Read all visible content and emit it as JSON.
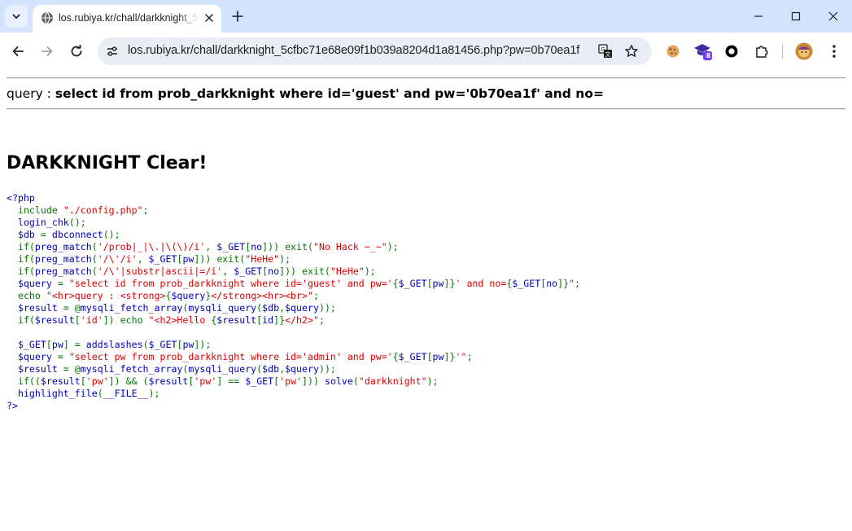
{
  "browser": {
    "tab": {
      "title": "los.rubiya.kr/chall/darkknight_5"
    },
    "url": "los.rubiya.kr/chall/darkknight_5cfbc71e68e09f1b039a8204d1a81456.php?pw=0b70ea1f",
    "extension_badge": "8",
    "icons": {
      "tab_search": "chevron-down-icon",
      "favicon": "globe-icon",
      "close": "close-icon",
      "new_tab": "plus-icon",
      "minimize": "minimize-icon",
      "maximize": "maximize-icon",
      "window_close": "close-icon",
      "back": "back-arrow-icon",
      "forward": "forward-arrow-icon",
      "reload": "reload-icon",
      "site_info": "tune-icon",
      "translate": "translate-icon",
      "bookmark": "star-icon",
      "extensions": "puzzle-icon",
      "menu": "kebab-menu-icon"
    }
  },
  "page": {
    "query_label": "query : ",
    "query_text": "select id from prob_darkknight where id='guest' and pw='0b70ea1f' and no=",
    "clear_message": "DARKKNIGHT Clear!",
    "source_lines": [
      [
        {
          "c": "d",
          "t": "<?php"
        }
      ],
      [
        {
          "c": "k",
          "t": "  include "
        },
        {
          "c": "s",
          "t": "\"./config.php\""
        },
        {
          "c": "k",
          "t": ";"
        }
      ],
      [
        {
          "c": "d",
          "t": "  login_chk"
        },
        {
          "c": "k",
          "t": "();"
        }
      ],
      [
        {
          "c": "d",
          "t": "  $db "
        },
        {
          "c": "k",
          "t": "= "
        },
        {
          "c": "d",
          "t": "dbconnect"
        },
        {
          "c": "k",
          "t": "();"
        }
      ],
      [
        {
          "c": "k",
          "t": "  if("
        },
        {
          "c": "d",
          "t": "preg_match"
        },
        {
          "c": "k",
          "t": "("
        },
        {
          "c": "s",
          "t": "'/prob|_|\\.|\\(\\)/i'"
        },
        {
          "c": "k",
          "t": ", "
        },
        {
          "c": "d",
          "t": "$_GET"
        },
        {
          "c": "k",
          "t": "["
        },
        {
          "c": "d",
          "t": "no"
        },
        {
          "c": "k",
          "t": "])) exit("
        },
        {
          "c": "s",
          "t": "\"No Hack ~_~\""
        },
        {
          "c": "k",
          "t": ");"
        }
      ],
      [
        {
          "c": "k",
          "t": "  if("
        },
        {
          "c": "d",
          "t": "preg_match"
        },
        {
          "c": "k",
          "t": "("
        },
        {
          "c": "s",
          "t": "'/\\'/i'"
        },
        {
          "c": "k",
          "t": ", "
        },
        {
          "c": "d",
          "t": "$_GET"
        },
        {
          "c": "k",
          "t": "["
        },
        {
          "c": "d",
          "t": "pw"
        },
        {
          "c": "k",
          "t": "])) exit("
        },
        {
          "c": "s",
          "t": "\"HeHe\""
        },
        {
          "c": "k",
          "t": ");"
        }
      ],
      [
        {
          "c": "k",
          "t": "  if("
        },
        {
          "c": "d",
          "t": "preg_match"
        },
        {
          "c": "k",
          "t": "("
        },
        {
          "c": "s",
          "t": "'/\\'|substr|ascii|=/i'"
        },
        {
          "c": "k",
          "t": ", "
        },
        {
          "c": "d",
          "t": "$_GET"
        },
        {
          "c": "k",
          "t": "["
        },
        {
          "c": "d",
          "t": "no"
        },
        {
          "c": "k",
          "t": "])) exit("
        },
        {
          "c": "s",
          "t": "\"HeHe\""
        },
        {
          "c": "k",
          "t": ");"
        }
      ],
      [
        {
          "c": "d",
          "t": "  $query "
        },
        {
          "c": "k",
          "t": "= "
        },
        {
          "c": "s",
          "t": "\"select id from prob_darkknight where id='guest' and pw='"
        },
        {
          "c": "k",
          "t": "{"
        },
        {
          "c": "d",
          "t": "$_GET"
        },
        {
          "c": "k",
          "t": "["
        },
        {
          "c": "d",
          "t": "pw"
        },
        {
          "c": "k",
          "t": "]}"
        },
        {
          "c": "s",
          "t": "' and no="
        },
        {
          "c": "k",
          "t": "{"
        },
        {
          "c": "d",
          "t": "$_GET"
        },
        {
          "c": "k",
          "t": "["
        },
        {
          "c": "d",
          "t": "no"
        },
        {
          "c": "k",
          "t": "]}"
        },
        {
          "c": "s",
          "t": "\""
        },
        {
          "c": "k",
          "t": ";"
        }
      ],
      [
        {
          "c": "k",
          "t": "  echo "
        },
        {
          "c": "s",
          "t": "\"<hr>query : <strong>"
        },
        {
          "c": "k",
          "t": "{"
        },
        {
          "c": "d",
          "t": "$query"
        },
        {
          "c": "k",
          "t": "}"
        },
        {
          "c": "s",
          "t": "</strong><hr><br>\""
        },
        {
          "c": "k",
          "t": ";"
        }
      ],
      [
        {
          "c": "d",
          "t": "  $result "
        },
        {
          "c": "k",
          "t": "= @"
        },
        {
          "c": "d",
          "t": "mysqli_fetch_array"
        },
        {
          "c": "k",
          "t": "("
        },
        {
          "c": "d",
          "t": "mysqli_query"
        },
        {
          "c": "k",
          "t": "("
        },
        {
          "c": "d",
          "t": "$db"
        },
        {
          "c": "k",
          "t": ","
        },
        {
          "c": "d",
          "t": "$query"
        },
        {
          "c": "k",
          "t": "));"
        }
      ],
      [
        {
          "c": "k",
          "t": "  if("
        },
        {
          "c": "d",
          "t": "$result"
        },
        {
          "c": "k",
          "t": "["
        },
        {
          "c": "s",
          "t": "'id'"
        },
        {
          "c": "k",
          "t": "]) echo "
        },
        {
          "c": "s",
          "t": "\"<h2>Hello "
        },
        {
          "c": "k",
          "t": "{"
        },
        {
          "c": "d",
          "t": "$result"
        },
        {
          "c": "k",
          "t": "["
        },
        {
          "c": "d",
          "t": "id"
        },
        {
          "c": "k",
          "t": "]}"
        },
        {
          "c": "s",
          "t": "</h2>\""
        },
        {
          "c": "k",
          "t": ";"
        }
      ],
      [
        {
          "c": "k",
          "t": ""
        }
      ],
      [
        {
          "c": "d",
          "t": "  $_GET"
        },
        {
          "c": "k",
          "t": "["
        },
        {
          "c": "d",
          "t": "pw"
        },
        {
          "c": "k",
          "t": "] = "
        },
        {
          "c": "d",
          "t": "addslashes"
        },
        {
          "c": "k",
          "t": "("
        },
        {
          "c": "d",
          "t": "$_GET"
        },
        {
          "c": "k",
          "t": "["
        },
        {
          "c": "d",
          "t": "pw"
        },
        {
          "c": "k",
          "t": "]);"
        }
      ],
      [
        {
          "c": "d",
          "t": "  $query "
        },
        {
          "c": "k",
          "t": "= "
        },
        {
          "c": "s",
          "t": "\"select pw from prob_darkknight where id='admin' and pw='"
        },
        {
          "c": "k",
          "t": "{"
        },
        {
          "c": "d",
          "t": "$_GET"
        },
        {
          "c": "k",
          "t": "["
        },
        {
          "c": "d",
          "t": "pw"
        },
        {
          "c": "k",
          "t": "]}"
        },
        {
          "c": "s",
          "t": "'\""
        },
        {
          "c": "k",
          "t": ";"
        }
      ],
      [
        {
          "c": "d",
          "t": "  $result "
        },
        {
          "c": "k",
          "t": "= @"
        },
        {
          "c": "d",
          "t": "mysqli_fetch_array"
        },
        {
          "c": "k",
          "t": "("
        },
        {
          "c": "d",
          "t": "mysqli_query"
        },
        {
          "c": "k",
          "t": "("
        },
        {
          "c": "d",
          "t": "$db"
        },
        {
          "c": "k",
          "t": ","
        },
        {
          "c": "d",
          "t": "$query"
        },
        {
          "c": "k",
          "t": "));"
        }
      ],
      [
        {
          "c": "k",
          "t": "  if(("
        },
        {
          "c": "d",
          "t": "$result"
        },
        {
          "c": "k",
          "t": "["
        },
        {
          "c": "s",
          "t": "'pw'"
        },
        {
          "c": "k",
          "t": "]) && ("
        },
        {
          "c": "d",
          "t": "$result"
        },
        {
          "c": "k",
          "t": "["
        },
        {
          "c": "s",
          "t": "'pw'"
        },
        {
          "c": "k",
          "t": "] == "
        },
        {
          "c": "d",
          "t": "$_GET"
        },
        {
          "c": "k",
          "t": "["
        },
        {
          "c": "s",
          "t": "'pw'"
        },
        {
          "c": "k",
          "t": "])) "
        },
        {
          "c": "d",
          "t": "solve"
        },
        {
          "c": "k",
          "t": "("
        },
        {
          "c": "s",
          "t": "\"darkknight\""
        },
        {
          "c": "k",
          "t": ");"
        }
      ],
      [
        {
          "c": "d",
          "t": "  highlight_file"
        },
        {
          "c": "k",
          "t": "("
        },
        {
          "c": "d",
          "t": "__FILE__"
        },
        {
          "c": "k",
          "t": ");"
        }
      ],
      [
        {
          "c": "d",
          "t": "?>"
        }
      ]
    ]
  },
  "colors": {
    "titlebar": "#d3e3fd",
    "omnibox": "#e9eef6",
    "php_default": "#0000bb",
    "php_keyword": "#007700",
    "php_string": "#dd0000"
  }
}
